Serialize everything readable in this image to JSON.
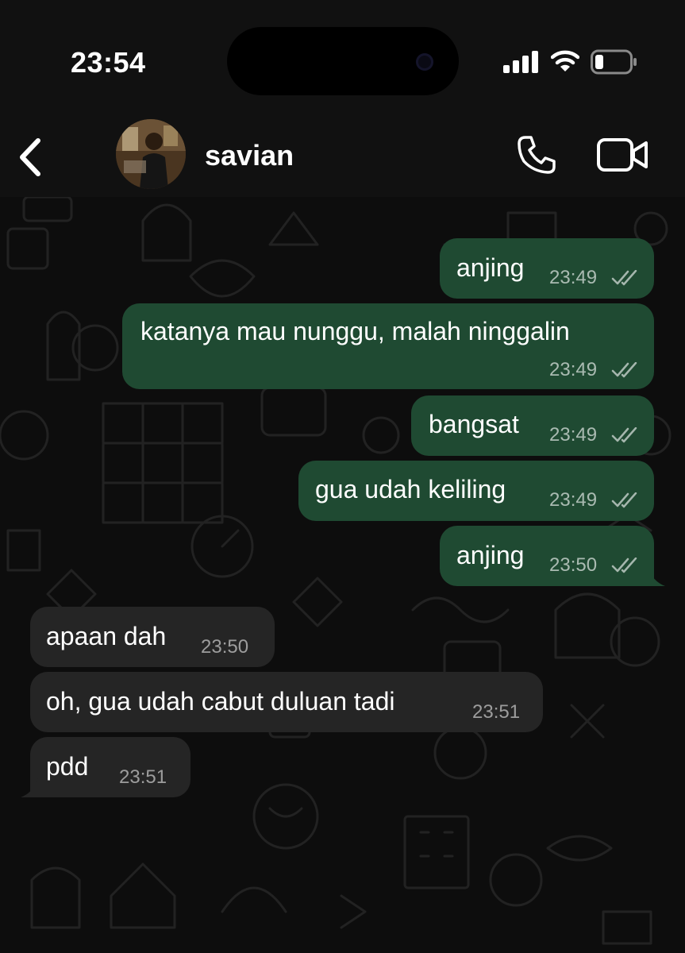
{
  "status": {
    "time": "23:54"
  },
  "header": {
    "contact_name": "savian"
  },
  "theme": {
    "outgoing": "#1f4a32",
    "incoming": "#252525",
    "background": "#0d0d0d"
  },
  "messages": [
    {
      "text": "anjing",
      "time": "23:49",
      "direction": "out",
      "status": "read"
    },
    {
      "text": "katanya mau nunggu, malah ninggalin",
      "time": "23:49",
      "direction": "out",
      "status": "read"
    },
    {
      "text": "bangsat",
      "time": "23:49",
      "direction": "out",
      "status": "read"
    },
    {
      "text": "gua udah keliling",
      "time": "23:49",
      "direction": "out",
      "status": "read"
    },
    {
      "text": "anjing",
      "time": "23:50",
      "direction": "out",
      "status": "read"
    },
    {
      "text": "apaan dah",
      "time": "23:50",
      "direction": "in"
    },
    {
      "text": "oh, gua udah cabut duluan tadi",
      "time": "23:51",
      "direction": "in"
    },
    {
      "text": "pdd",
      "time": "23:51",
      "direction": "in"
    }
  ]
}
